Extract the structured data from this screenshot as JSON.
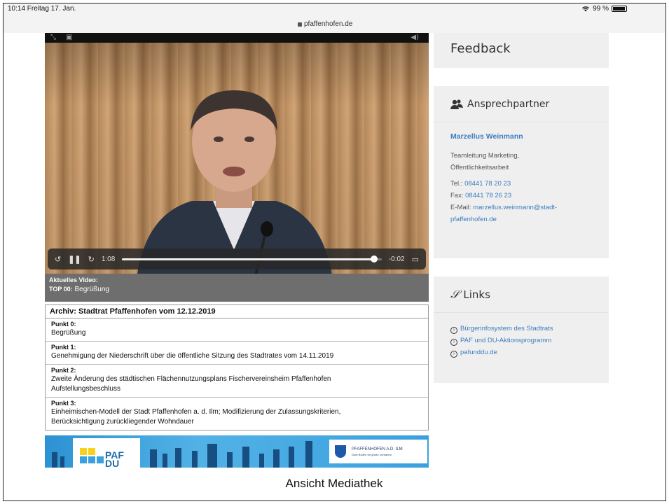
{
  "status_bar": {
    "time_date": "10:14  Freitag 17. Jan.",
    "battery": "99 %",
    "url": "pfaffenhofen.de"
  },
  "video": {
    "elapsed": "1:08",
    "remaining": "-0:02",
    "progress_fraction": 0.97
  },
  "current_video": {
    "label": "Aktuelles Video:",
    "top_id": "TOP 00:",
    "top_title": "Begrüßung"
  },
  "archive": {
    "title": "Archiv: Stadtrat Pfaffenhofen vom 12.12.2019",
    "points": [
      {
        "label": "Punkt 0:",
        "text": "Begrüßung"
      },
      {
        "label": "Punkt 1:",
        "text": "Genehmigung der Niederschrift über die öffentliche Sitzung des Stadtrates vom 14.11.2019"
      },
      {
        "label": "Punkt 2:",
        "text": "Zweite Änderung des städtischen Flächennutzungsplans Fischervereinsheim Pfaffenhofen Aufstellungsbeschluss"
      },
      {
        "label": "Punkt 3:",
        "text": "Einheimischen-Modell der Stadt Pfaffenhofen a. d. Ilm; Modifizierung der Zulassungskriterien, Berücksichtigung zurückliegender Wohndauer"
      }
    ]
  },
  "banner": {
    "logo_text": "PAF DU",
    "crest_title": "PFAFFENHOFEN A.D. ILM",
    "crest_sub": "Gute Boden für große Vorhaben"
  },
  "sidebar": {
    "feedback_title": "Feedback",
    "contact": {
      "title": "Ansprechpartner",
      "name": "Marzellus Weinmann",
      "role_line1": "Teamleitung Marketing,",
      "role_line2": "Öffentlichkeitsarbeit",
      "tel_label": "Tel.:",
      "tel": "08441 78 20 23",
      "fax_label": "Fax:",
      "fax": "08441 78 26 23",
      "email_label": "E-Mail:",
      "email_line1": "marzellus.weinmann@stadt-",
      "email_line2": "pfaffenhofen.de"
    },
    "links": {
      "title": "Links",
      "items": [
        "Bürgerinfosystem des Stadtrats",
        "PAF und DU-Aktionsprogramm",
        "pafunddu.de"
      ]
    }
  },
  "caption": "Ansicht Mediathek"
}
